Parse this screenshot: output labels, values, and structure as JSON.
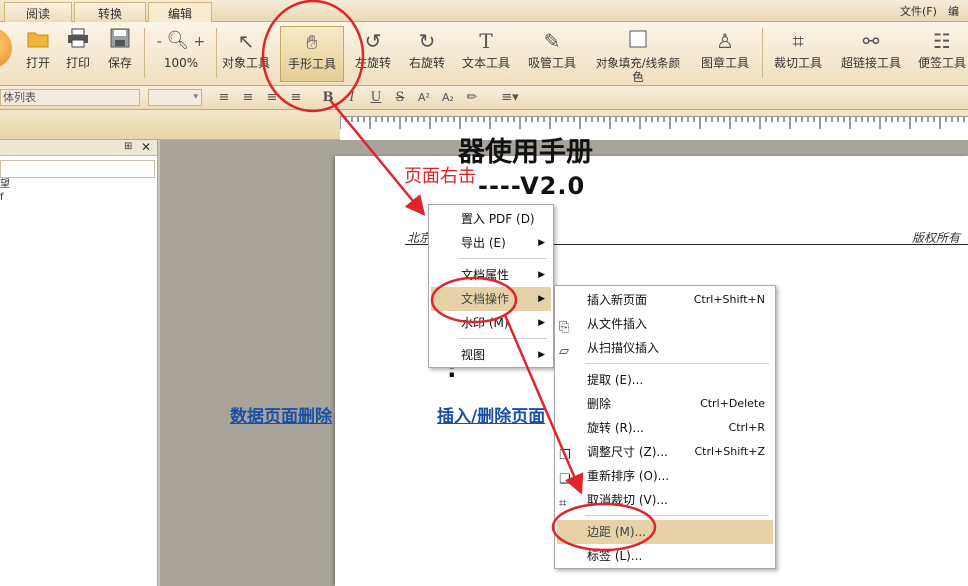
{
  "tabs": [
    {
      "label": "阅读"
    },
    {
      "label": "转换"
    },
    {
      "label": "编辑"
    }
  ],
  "menu_right": {
    "file": "文件(F)",
    "edit": "编辑"
  },
  "ribbon": {
    "open": "打开",
    "print": "打印",
    "save": "保存",
    "zoom_minus": "-",
    "zoom_plus": "+",
    "zoom": "100%",
    "object_tool": "对象工具",
    "hand_tool": "手形工具",
    "rotate_left": "左旋转",
    "rotate_right": "右旋转",
    "text_tool": "文本工具",
    "eyedropper_tool": "吸管工具",
    "fill_line_color": "对象填充/线条颜色",
    "stamp_tool": "图章工具",
    "crop_tool": "裁切工具",
    "hyperlink_tool": "超链接工具",
    "note_tool": "便签工具"
  },
  "format_bar": {
    "font_list": "体列表",
    "size_arrow": "▾",
    "bold": "B",
    "italic": "I",
    "underline": "U",
    "strike": "S",
    "superscript": "A²",
    "subscript": "A₂"
  },
  "panel": {
    "pin": "⊞",
    "close": "✕",
    "items": [
      "望",
      "f"
    ]
  },
  "document": {
    "header_left": "北京",
    "header_right": "版权所有",
    "title": "器使用手册",
    "version": "----V2.0",
    "colon": ":",
    "link_left": "数据页面删除",
    "link_right": "插入/删除页面"
  },
  "annotation": {
    "text": "页面右击"
  },
  "context_menu": {
    "items": [
      {
        "label": "置入 PDF (D)",
        "arrow": ""
      },
      {
        "label": "导出 (E)",
        "arrow": "▶"
      },
      {
        "label": "文档属性",
        "arrow": "▶"
      },
      {
        "label": "文档操作",
        "arrow": "▶"
      },
      {
        "label": "水印 (M)",
        "arrow": "▶"
      },
      {
        "label": "视图",
        "arrow": "▶"
      }
    ]
  },
  "submenu": {
    "items": [
      {
        "label": "插入新页面",
        "shortcut": "Ctrl+Shift+N"
      },
      {
        "label": "从文件插入",
        "shortcut": ""
      },
      {
        "label": "从扫描仪插入",
        "shortcut": ""
      },
      {
        "label": "提取 (E)...",
        "shortcut": ""
      },
      {
        "label": "删除",
        "shortcut": "Ctrl+Delete"
      },
      {
        "label": "旋转 (R)...",
        "shortcut": "Ctrl+R"
      },
      {
        "label": "调整尺寸 (Z)...",
        "shortcut": "Ctrl+Shift+Z"
      },
      {
        "label": "重新排序 (O)...",
        "shortcut": ""
      },
      {
        "label": "取消裁切 (V)...",
        "shortcut": ""
      },
      {
        "label": "边距 (M)...",
        "shortcut": ""
      },
      {
        "label": "标签 (L)...",
        "shortcut": ""
      }
    ]
  },
  "colors": {
    "annotation_red": "#e0242a",
    "highlight": "#e6d2a6",
    "link_blue": "#1a4fa8"
  }
}
